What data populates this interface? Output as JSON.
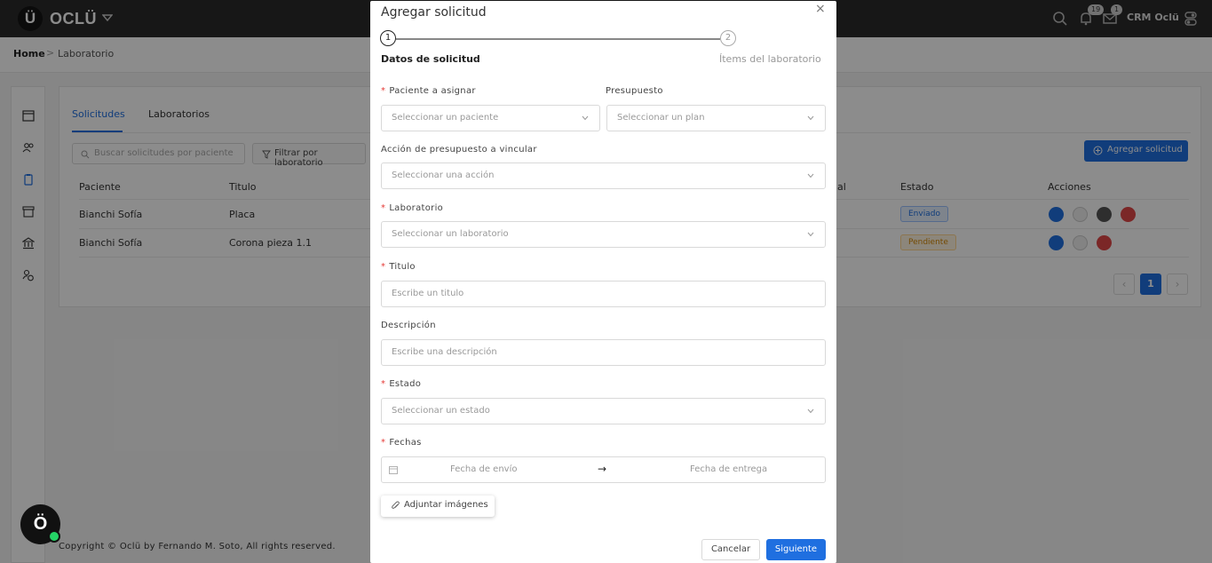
{
  "header": {
    "logo_letter": "Ü",
    "brand": "OCLÜ",
    "notifications_count": "19",
    "messages_count": "1",
    "user_label": "CRM Oclü"
  },
  "breadcrumb": {
    "home": "Home",
    "separator": ">",
    "current": "Laboratorio"
  },
  "tabs": [
    {
      "label": "Solicitudes",
      "active": true
    },
    {
      "label": "Laboratorios",
      "active": false
    }
  ],
  "toolbar": {
    "search_placeholder": "Buscar solicitudes por paciente",
    "filter_label": "Filtrar por laboratorio",
    "add_label": "Agregar solicitud"
  },
  "table": {
    "columns": [
      "Paciente",
      "Titulo",
      "al",
      "Estado",
      "Acciones"
    ],
    "rows": [
      {
        "paciente": "Bianchi Sofía",
        "titulo": "Placa",
        "estado": "Enviado"
      },
      {
        "paciente": "Bianchi Sofía",
        "titulo": "Corona pieza 1.1",
        "estado": "Pendiente"
      }
    ]
  },
  "pagination": {
    "current_page": "1",
    "prev": "‹",
    "next": "›"
  },
  "footer": {
    "copyright": "Copyright © Oclü by Fernando M. Soto, All rights reserved."
  },
  "chat": {
    "letter": "Ö"
  },
  "modal": {
    "title": "Agregar solicitud",
    "close": "×",
    "steps": [
      {
        "number": "1",
        "label": "Datos de solicitud"
      },
      {
        "number": "2",
        "label": "Ítems del laboratorio"
      }
    ],
    "fields": {
      "paciente": {
        "label": "Paciente a asignar",
        "placeholder": "Seleccionar un paciente"
      },
      "presupuesto": {
        "label": "Presupuesto",
        "placeholder": "Seleccionar un plan"
      },
      "accion": {
        "label": "Acción de presupuesto a vincular",
        "placeholder": "Seleccionar una acción"
      },
      "laboratorio": {
        "label": "Laboratorio",
        "placeholder": "Seleccionar un laboratorio"
      },
      "titulo": {
        "label": "Titulo",
        "placeholder": "Escribe un titulo"
      },
      "descripcion": {
        "label": "Descripción",
        "placeholder": "Escribe una descripción"
      },
      "estado": {
        "label": "Estado",
        "placeholder": "Seleccionar un estado"
      },
      "fechas": {
        "label": "Fechas",
        "start_placeholder": "Fecha de envío",
        "arrow": "→",
        "end_placeholder": "Fecha de entrega"
      }
    },
    "required_mark": "*",
    "attach_label": "Adjuntar imágenes",
    "cancel_label": "Cancelar",
    "next_label": "Siguiente"
  },
  "colors": {
    "primary": "#1f6fe0",
    "topbar": "#2b2b2b",
    "required": "#e53935",
    "danger": "#e04848"
  }
}
